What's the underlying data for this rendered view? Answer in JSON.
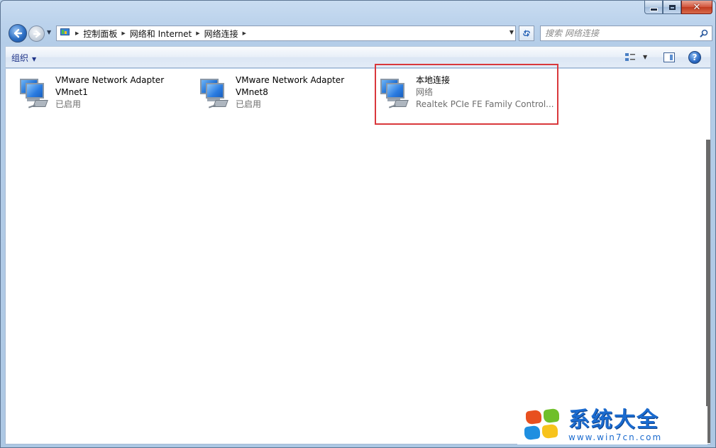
{
  "window": {
    "caption": {
      "minimize_icon": "minimize-icon",
      "maximize_icon": "maximize-icon",
      "close_icon": "close-icon",
      "close_glyph": "✕"
    }
  },
  "nav": {
    "breadcrumb": [
      "控制面板",
      "网络和 Internet",
      "网络连接"
    ],
    "search_placeholder": "搜索 网络连接"
  },
  "toolbar": {
    "organize_label": "组织",
    "help_glyph": "?"
  },
  "connections": [
    {
      "name": "VMware Network Adapter",
      "line2": "VMnet1",
      "status": "已启用"
    },
    {
      "name": "VMware Network Adapter",
      "line2": "VMnet8",
      "status": "已启用"
    },
    {
      "name": "本地连接",
      "line2": "网络",
      "status": "Realtek PCIe FE Family Control...",
      "selected": true
    }
  ],
  "watermark": {
    "title": "系统大全",
    "url": "www.win7cn.com"
  },
  "colors": {
    "accent": "#1e3287",
    "highlight_border": "#d9383c",
    "watermark_blue": "#1b6bcf"
  }
}
